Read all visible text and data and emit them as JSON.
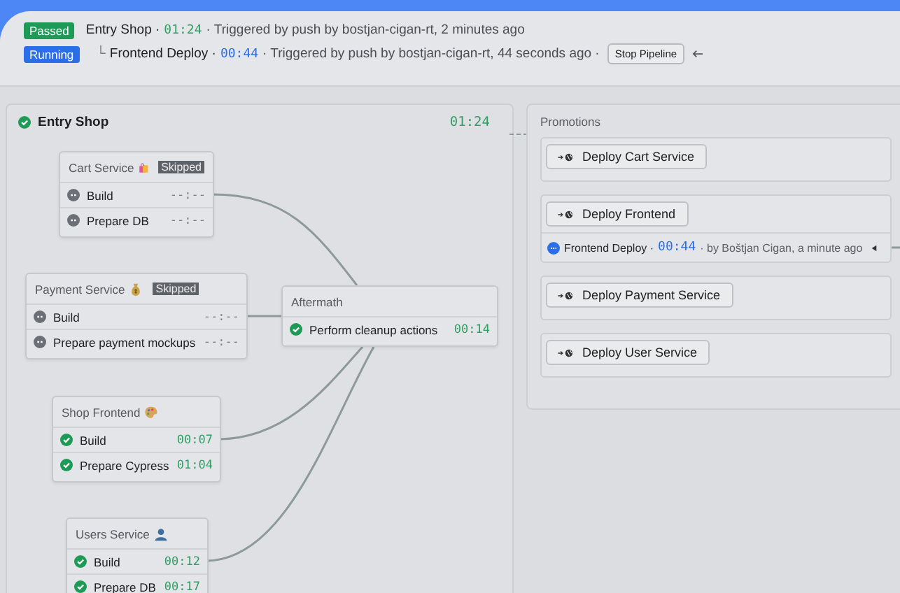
{
  "header": {
    "runs": [
      {
        "kind": "passed",
        "badge": "Passed",
        "child": false,
        "name": "Entry Shop ·",
        "duration": "01:24",
        "trigger": "· Triggered by push by bostjan-cigan-rt, 2 minutes ago"
      },
      {
        "kind": "running",
        "badge": "Running",
        "child": true,
        "branch": "└",
        "name": "Frontend Deploy ·",
        "duration": "00:44",
        "trigger": "· Triggered by push by bostjan-cigan-rt, 44 seconds ago ·",
        "stop_button": "Stop Pipeline"
      }
    ]
  },
  "pipeline": {
    "title": "Entry Shop",
    "kind": "passed",
    "duration": "01:24",
    "blocks": [
      {
        "name": "Cart Service",
        "badge": "Skipped",
        "jobs": [
          {
            "name": "Build",
            "kind": "skipped",
            "duration": "--:--"
          },
          {
            "name": "Prepare DB",
            "kind": "skipped",
            "duration": "--:--"
          }
        ]
      },
      {
        "name": "Payment Service",
        "badge": "Skipped",
        "jobs": [
          {
            "name": "Build",
            "kind": "skipped",
            "duration": "--:--"
          },
          {
            "name": "Prepare payment mockups",
            "kind": "skipped",
            "duration": "--:--"
          }
        ]
      },
      {
        "name": "Aftermath",
        "jobs": [
          {
            "name": "Perform cleanup actions",
            "kind": "passed",
            "duration": "00:14"
          }
        ]
      },
      {
        "name": "Shop Frontend",
        "jobs": [
          {
            "name": "Build",
            "kind": "passed",
            "duration": "00:07"
          },
          {
            "name": "Prepare Cypress",
            "kind": "passed",
            "duration": "01:04"
          }
        ]
      },
      {
        "name": "Users Service",
        "jobs": [
          {
            "name": "Build",
            "kind": "passed",
            "duration": "00:12"
          },
          {
            "name": "Prepare DB",
            "kind": "passed",
            "duration": "00:17"
          }
        ]
      }
    ]
  },
  "promotions": {
    "title": "Promotions",
    "items": [
      {
        "button": "Deploy Cart Service"
      },
      {
        "button": "Deploy Frontend",
        "run": {
          "kind": "running",
          "name": "Frontend Deploy ·",
          "duration": "00:44",
          "by": "· by Boštjan Cigan, a minute ago"
        }
      },
      {
        "button": "Deploy Payment Service"
      },
      {
        "button": "Deploy User Service"
      }
    ]
  }
}
